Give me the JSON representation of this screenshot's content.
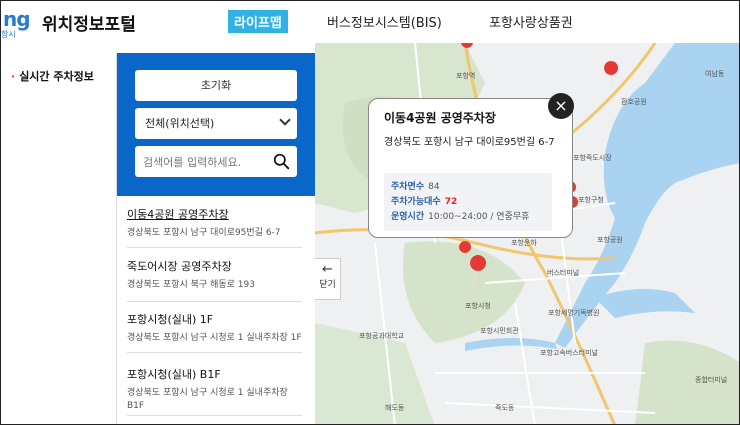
{
  "header": {
    "logo_mark": "ng",
    "logo_sub": "항시",
    "site_title": "위치정보포털",
    "nav": [
      "라이프맵",
      "버스정보시스템(BIS)",
      "포항사랑상품권"
    ]
  },
  "leftmenu": {
    "item": "실시간 주차정보"
  },
  "panel": {
    "reset_label": "초기화",
    "select_value": "전체(위치선택)",
    "search_placeholder": "검색어를 입력하세요."
  },
  "list": [
    {
      "name": "이동4공원 공영주차장",
      "addr": "경상북도 포항시 남구 대이로95번길 6-7"
    },
    {
      "name": "죽도어시장 공영주차장",
      "addr": "경상북도 포항시 북구 해동로 193"
    },
    {
      "name": "포항시청(실내) 1F",
      "addr": "경상북도 포항시 남구 시청로 1 실내주차장 1F"
    },
    {
      "name": "포항시청(실내) B1F",
      "addr": "경상북도 포항시 남구 시청로 1 실내주차장 B1F"
    }
  ],
  "map": {
    "close_label": "닫기",
    "labels": [
      "포항역",
      "환호공원",
      "여남동",
      "포항죽도시장",
      "포항구청",
      "포항공원",
      "포항운하",
      "버스터미널",
      "포항세명기독병원",
      "포항시청",
      "포항시민회관",
      "포항공과대학교",
      "포항고속버스터미널",
      "종합터미널",
      "죽도동",
      "해도동"
    ]
  },
  "popup": {
    "title": "이동4공원 공영주차장",
    "addr": "경상북도 포항시 남구 대이로95번길 6-7",
    "total_label": "주차면수",
    "total_value": "84",
    "avail_label": "주차가능대수",
    "avail_value": "72",
    "hours_label": "운영시간",
    "hours_value": "10:00~24:00 / 연중무휴",
    "close_glyph": "×"
  },
  "colors": {
    "panel_blue": "#0a66c9",
    "nav_active": "#31b1e6",
    "marker_red": "#e53935",
    "water": "#a9d3f0"
  }
}
